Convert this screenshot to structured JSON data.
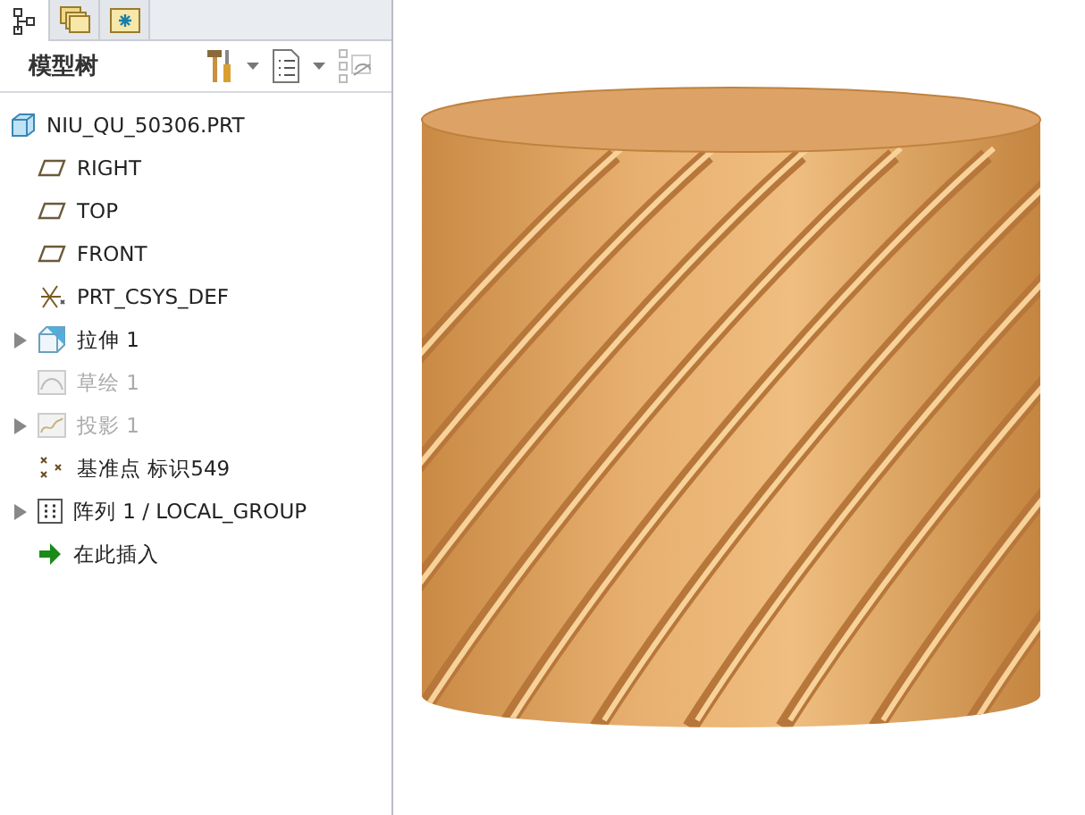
{
  "tabs": [
    {
      "kind": "tree",
      "selected": true
    },
    {
      "kind": "layers",
      "selected": false
    },
    {
      "kind": "favorites",
      "selected": false
    }
  ],
  "panel": {
    "title": "模型树"
  },
  "tree": {
    "label": "NIU_QU_50306.PRT",
    "kind": "part",
    "children": [
      {
        "label": "RIGHT",
        "kind": "plane",
        "expandable": false,
        "disabled": false
      },
      {
        "label": "TOP",
        "kind": "plane",
        "expandable": false,
        "disabled": false
      },
      {
        "label": "FRONT",
        "kind": "plane",
        "expandable": false,
        "disabled": false
      },
      {
        "label": "PRT_CSYS_DEF",
        "kind": "csys",
        "expandable": false,
        "disabled": false
      },
      {
        "label": "拉伸 1",
        "kind": "extrude",
        "expandable": true,
        "disabled": false
      },
      {
        "label": "草绘 1",
        "kind": "sketch",
        "expandable": false,
        "disabled": true
      },
      {
        "label": "投影 1",
        "kind": "projection",
        "expandable": true,
        "disabled": true
      },
      {
        "label": "基准点 标识549",
        "kind": "point",
        "expandable": false,
        "disabled": false
      },
      {
        "label": "阵列 1 / LOCAL_GROUP",
        "kind": "pattern",
        "expandable": true,
        "disabled": false
      },
      {
        "label": "在此插入",
        "kind": "insert",
        "expandable": false,
        "disabled": false
      }
    ]
  }
}
